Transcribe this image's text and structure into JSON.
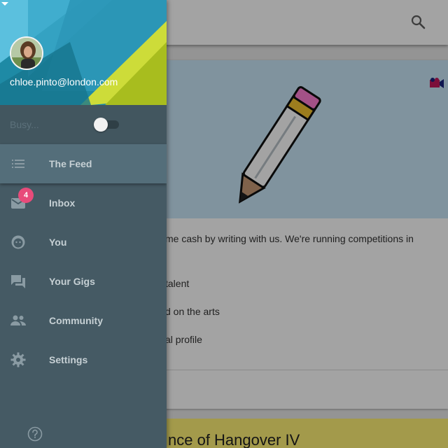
{
  "drawer": {
    "account": {
      "email": "chloe.pinto@london.com"
    },
    "status": {
      "label": "Busy...",
      "toggle_on": false
    },
    "nav_items": [
      {
        "label": "The Feed",
        "icon": "list-icon",
        "active": true
      },
      {
        "label": "Inbox",
        "icon": "mail-icon",
        "badge": "4"
      },
      {
        "label": "You",
        "icon": "face-icon"
      },
      {
        "label": "Your Gigs",
        "icon": "forum-icon"
      },
      {
        "label": "Community",
        "icon": "people-icon"
      },
      {
        "label": "Settings",
        "icon": "gear-icon"
      }
    ],
    "help_icon": "help-icon"
  },
  "background": {
    "card_text": {
      "line1": "me cash by writing with us. We're running competitions in",
      "line2": "talent",
      "line3": "d on the arts",
      "line4": "al profile"
    },
    "next_card_title": "nce of Hangover IV"
  },
  "colors": {
    "drawer_bg": "#455a64",
    "active_item_bg": "#546e7a",
    "badge": "#e84b7a",
    "header_teal": "#1e8aa5",
    "header_lime": "#cddc39"
  }
}
